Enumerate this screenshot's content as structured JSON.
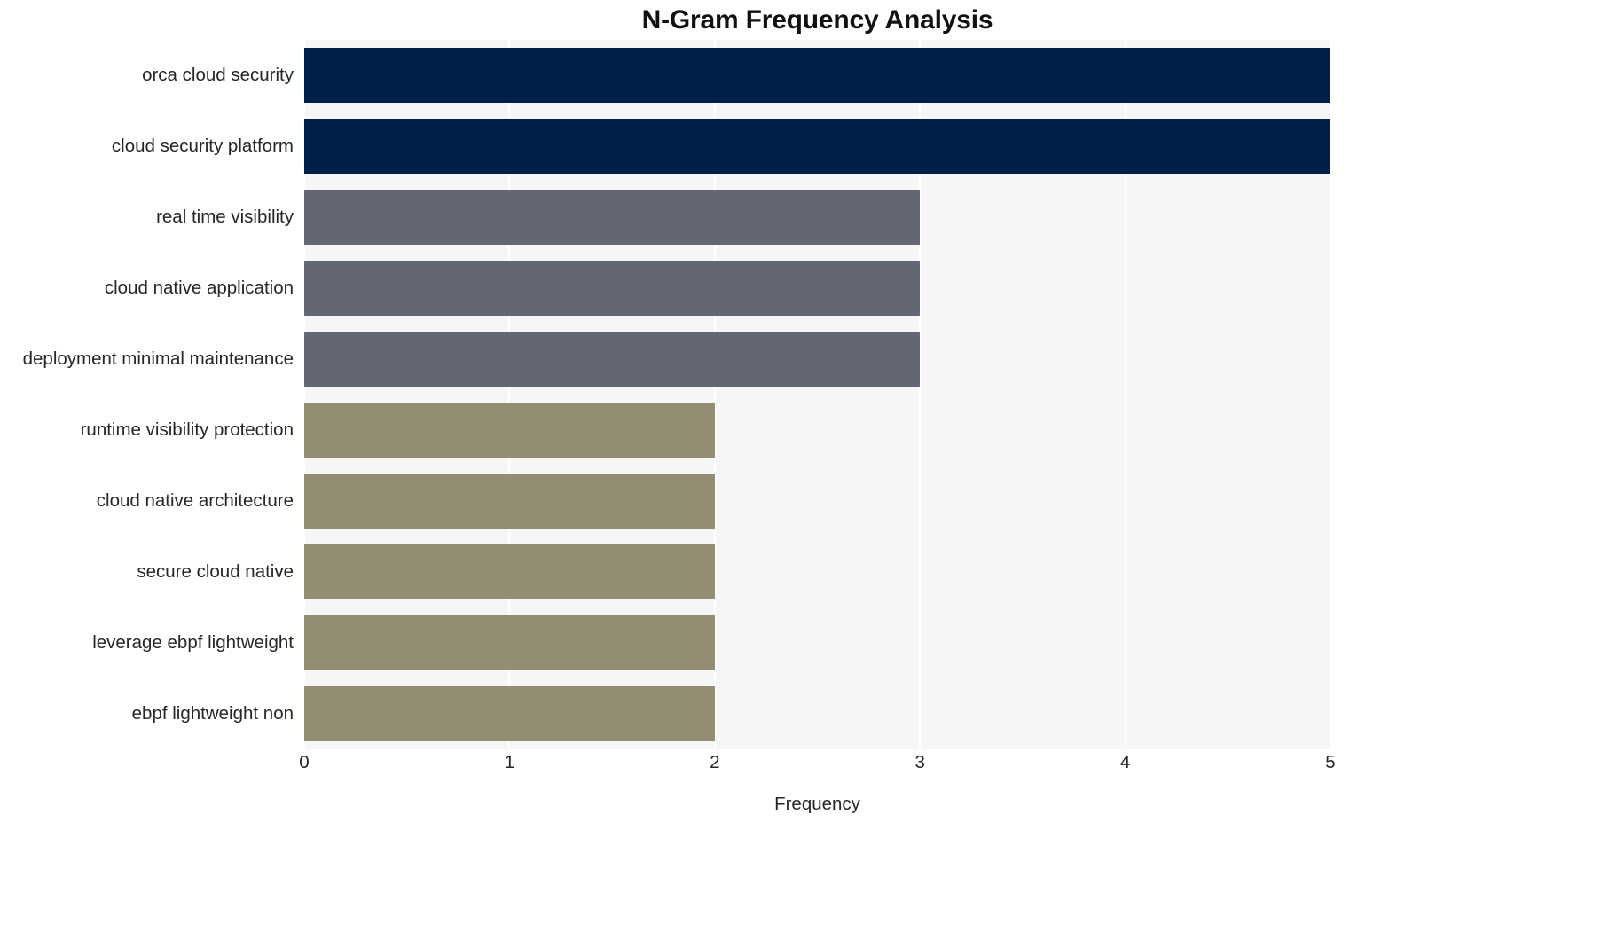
{
  "chart_data": {
    "type": "bar",
    "orientation": "horizontal",
    "title": "N-Gram Frequency Analysis",
    "xlabel": "Frequency",
    "ylabel": "",
    "categories": [
      "orca cloud security",
      "cloud security platform",
      "real time visibility",
      "cloud native application",
      "deployment minimal maintenance",
      "runtime visibility protection",
      "cloud native architecture",
      "secure cloud native",
      "leverage ebpf lightweight",
      "ebpf lightweight non"
    ],
    "values": [
      5,
      5,
      3,
      3,
      3,
      2,
      2,
      2,
      2,
      2
    ],
    "bar_colors": [
      "#002049",
      "#002049",
      "#636673",
      "#636673",
      "#636673",
      "#938d73",
      "#938d73",
      "#938d73",
      "#938d73",
      "#938d73"
    ],
    "xlim": [
      0,
      5
    ],
    "x_ticks": [
      "0",
      "1",
      "2",
      "3",
      "4",
      "5"
    ],
    "x_tick_values": [
      0,
      1,
      2,
      3,
      4,
      5
    ],
    "grid": true,
    "grid_axis": "x",
    "legend": "none",
    "panel_background": "#f6f6f7",
    "gridline_color": "#ffffff",
    "figure_background": "#ffffff",
    "title_color": "#111111",
    "tick_label_color": "#262626"
  }
}
